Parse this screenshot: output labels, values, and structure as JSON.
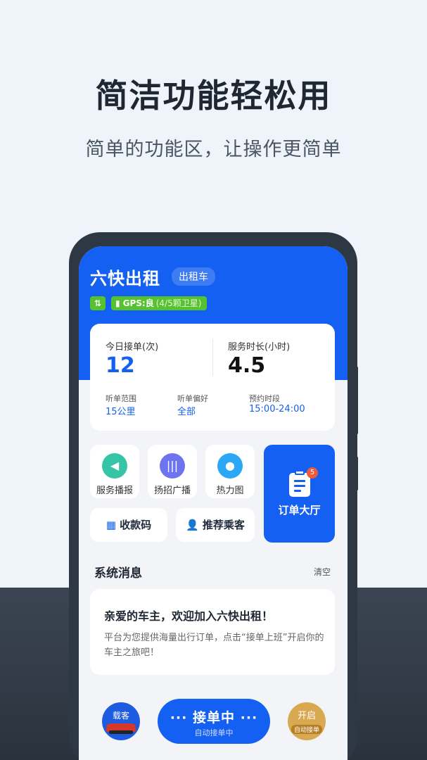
{
  "promo": {
    "headline": "简洁功能轻松用",
    "subline": "简单的功能区，让操作更简单"
  },
  "app": {
    "brand": "六快出租",
    "vehicle_type": "出租车",
    "signal_glyph": "⇅",
    "gps_label": "GPS:良",
    "gps_detail": "(4/5颗卫星)"
  },
  "stats": {
    "orders_label": "今日接单(次)",
    "orders_value": "12",
    "hours_label": "服务时长(小时)",
    "hours_value": "4.5",
    "range_label": "听单范围",
    "range_value": "15公里",
    "pref_label": "听单偏好",
    "pref_value": "全部",
    "slot_label": "预约时段",
    "slot_value": "15:00-24:00"
  },
  "tools": [
    {
      "label": "服务播报",
      "icon": "speaker-icon",
      "color": "#35c5a6"
    },
    {
      "label": "扬招广播",
      "icon": "voice-wave-icon",
      "color": "#6e74f0"
    },
    {
      "label": "热力图",
      "icon": "heatmap-icon",
      "color": "#2aa7f5"
    }
  ],
  "order_hall": {
    "label": "订单大厅",
    "badge": "5"
  },
  "pills": {
    "payment_code": "收款码",
    "recommend": "推荐乘客"
  },
  "messages": {
    "section_title": "系统消息",
    "clear": "清空",
    "title": "亲爱的车主，欢迎加入六快出租！",
    "body": "平台为您提供海量出行订单，点击“接单上班”开启你的车主之旅吧！"
  },
  "bottom": {
    "load_label": "载客",
    "take_main": "··· 接单中 ···",
    "take_sub": "自动接单中",
    "open_label": "开启",
    "open_sub": "自动接单"
  },
  "colors": {
    "brand_blue": "#1460f2",
    "gps_green": "#56c22f",
    "badge_red": "#f05a3c"
  }
}
